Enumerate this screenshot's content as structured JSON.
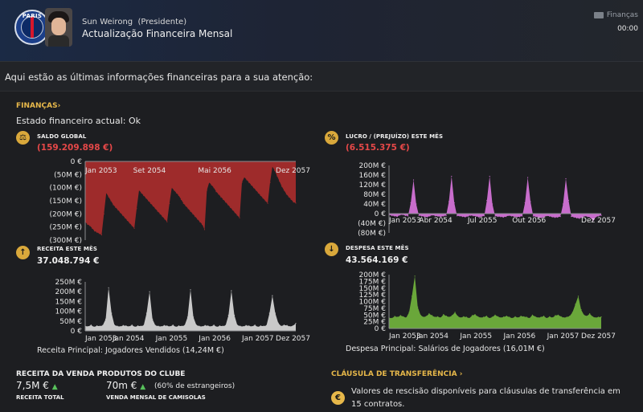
{
  "header": {
    "crest_text": "PARIS",
    "sender_name": "Sun Weirong",
    "sender_role": "(Presidente)",
    "subject": "Actualização Financeira Mensal",
    "tag": "Finanças",
    "time": "00:00"
  },
  "intro": "Aqui estão as últimas informações financeiras para a sua atenção:",
  "finances": {
    "section_label": "FINANÇAS",
    "status": "Estado financeiro actual: Ok"
  },
  "saldo": {
    "label": "SALDO GLOBAL",
    "value": "(159.209.898 €)"
  },
  "lucro": {
    "label": "LUCRO / (PREJUÍZO) ESTE MÊS",
    "value": "(6.515.375 €)"
  },
  "receita": {
    "label": "RECEITA ESTE MÊS",
    "value": "37.048.794 €",
    "principal": "Receita Principal: Jogadores Vendidos (14,24M €)"
  },
  "despesa": {
    "label": "DESPESA ESTE MÊS",
    "value": "43.564.169 €",
    "principal": "Despesa Principal: Salários de Jogadores (16,01M €)"
  },
  "vendas": {
    "title": "RECEITA DA VENDA PRODUTOS DO CLUBE",
    "total_value": "7,5M €",
    "total_label": "RECEITA TOTAL",
    "shirts_value": "70m €",
    "shirts_note": "(60% de estrangeiros)",
    "shirts_label": "VENDA MENSAL DE CAMISOLAS"
  },
  "clausula": {
    "title": "CLÁUSULA DE TRANSFERÊNCIA",
    "text": "Valores de rescisão disponíveis para cláusulas de transferência em 15 contratos."
  },
  "colors": {
    "accent": "#e7b84a",
    "negative": "#e54848",
    "balance_fill": "#9e2b2b",
    "profit_fill": "#c86dcc",
    "income_fill": "#c9c9c9",
    "expense_fill": "#6aa73a"
  },
  "icons": {
    "saldo": "balance-scale-icon",
    "lucro": "percent-icon",
    "receita": "arrow-up-icon",
    "despesa": "arrow-down-icon",
    "clausula": "euro-icon"
  },
  "chart_data": [
    {
      "id": "saldo",
      "type": "area",
      "title": "SALDO GLOBAL",
      "unit": "€",
      "ylim": [
        -300,
        0
      ],
      "yticks": [
        0,
        -50,
        -100,
        -150,
        -200,
        -250,
        -300
      ],
      "ytick_labels": [
        "0 €",
        "(50M €)",
        "(100M €)",
        "(150M €)",
        "(200M €)",
        "(250M €)",
        "(300M €)"
      ],
      "xtick_labels": [
        "Jan 2053",
        "Set 2054",
        "Mai 2056",
        "Dez 2057"
      ],
      "xtick_pos": [
        0.0,
        0.305,
        0.615,
        1.0
      ],
      "values": [
        -230,
        -240,
        -245,
        -255,
        -265,
        -270,
        -275,
        -280,
        -200,
        -120,
        -135,
        -150,
        -165,
        -175,
        -185,
        -195,
        -205,
        -215,
        -225,
        -235,
        -245,
        -255,
        -180,
        -110,
        -120,
        -130,
        -140,
        -150,
        -160,
        -170,
        -180,
        -190,
        -200,
        -210,
        -220,
        -230,
        -160,
        -100,
        -110,
        -120,
        -130,
        -145,
        -160,
        -170,
        -180,
        -190,
        -200,
        -210,
        -220,
        -230,
        -240,
        -260,
        -110,
        -80,
        -90,
        -100,
        -115,
        -125,
        -135,
        -145,
        -155,
        -165,
        -175,
        -185,
        -195,
        -205,
        -215,
        -80,
        -60,
        -70,
        -80,
        -90,
        -100,
        -110,
        -120,
        -130,
        -140,
        -150,
        -160,
        -80,
        -20,
        -35,
        -55,
        -75,
        -95,
        -110,
        -125,
        -135,
        -145,
        -155,
        -159
      ]
    },
    {
      "id": "lucro",
      "type": "area",
      "title": "LUCRO / (PREJUÍZO) ESTE MÊS",
      "unit": "€",
      "ylim": [
        -80,
        200
      ],
      "yticks": [
        200,
        160,
        120,
        80,
        40,
        0,
        -40,
        -80
      ],
      "ytick_labels": [
        "200M €",
        "160M €",
        "120M €",
        "80M €",
        "40M €",
        "0 €",
        "(40M €)",
        "(80M €)"
      ],
      "xtick_labels": [
        "Jan 2053",
        "Abr 2054",
        "Jul 2055",
        "Out 2056",
        "Dez 2057"
      ],
      "xtick_pos": [
        0.0,
        0.22,
        0.44,
        0.66,
        1.0
      ],
      "values": [
        -5,
        -8,
        -10,
        -12,
        -6,
        -4,
        -8,
        -10,
        45,
        140,
        40,
        -8,
        -10,
        -12,
        -14,
        -10,
        -6,
        -9,
        -11,
        -13,
        -10,
        -8,
        50,
        155,
        45,
        -9,
        -10,
        -12,
        -14,
        -11,
        -7,
        -9,
        -11,
        -14,
        -12,
        -9,
        55,
        155,
        40,
        -10,
        -12,
        -13,
        -15,
        -12,
        -8,
        -10,
        -12,
        -14,
        -13,
        -10,
        45,
        150,
        50,
        -10,
        -13,
        -15,
        -17,
        -14,
        -9,
        -11,
        -14,
        -16,
        -15,
        -12,
        40,
        145,
        55,
        -12,
        -15,
        -18,
        -20,
        -16,
        -10,
        -13,
        -16,
        -30,
        -14,
        -10,
        -7
      ]
    },
    {
      "id": "receita",
      "type": "area",
      "title": "RECEITA ESTE MÊS",
      "unit": "€",
      "ylim": [
        0,
        250
      ],
      "yticks": [
        0,
        50,
        100,
        150,
        200,
        250
      ],
      "ytick_labels": [
        "0 €",
        "50M €",
        "100M €",
        "150M €",
        "200M €",
        "250M €"
      ],
      "xtick_labels": [
        "Jan 2053",
        "Jan 2054",
        "Jan 2055",
        "Jan 2056",
        "Jan 2057",
        "Dez 2057"
      ],
      "xtick_pos": [
        0.0,
        0.205,
        0.41,
        0.615,
        0.82,
        1.0
      ],
      "values": [
        25,
        22,
        30,
        20,
        26,
        24,
        28,
        60,
        220,
        90,
        30,
        24,
        22,
        28,
        26,
        22,
        30,
        20,
        26,
        24,
        28,
        90,
        200,
        60,
        28,
        24,
        22,
        28,
        26,
        22,
        30,
        20,
        26,
        24,
        28,
        70,
        210,
        70,
        30,
        24,
        22,
        28,
        26,
        22,
        30,
        20,
        26,
        24,
        28,
        80,
        205,
        80,
        30,
        24,
        22,
        28,
        26,
        22,
        30,
        20,
        26,
        24,
        28,
        90,
        180,
        90,
        40,
        24,
        30,
        28,
        22,
        26,
        38
      ]
    },
    {
      "id": "despesa",
      "type": "area",
      "title": "DESPESA ESTE MÊS",
      "unit": "€",
      "ylim": [
        0,
        200
      ],
      "yticks": [
        0,
        25,
        50,
        75,
        100,
        125,
        150,
        175,
        200
      ],
      "ytick_labels": [
        "0 €",
        "25M €",
        "50M €",
        "75M €",
        "100M €",
        "125M €",
        "150M €",
        "175M €",
        "200M €"
      ],
      "xtick_labels": [
        "Jan 2053",
        "Jan 2054",
        "Jan 2055",
        "Jan 2056",
        "Jan 2057",
        "Dez 2057"
      ],
      "xtick_pos": [
        0.0,
        0.205,
        0.41,
        0.615,
        0.82,
        1.0
      ],
      "values": [
        40,
        38,
        45,
        42,
        48,
        44,
        40,
        60,
        120,
        195,
        80,
        50,
        42,
        45,
        55,
        48,
        42,
        44,
        40,
        52,
        46,
        42,
        48,
        60,
        45,
        40,
        44,
        42,
        38,
        48,
        52,
        44,
        40,
        42,
        46,
        38,
        42,
        50,
        44,
        40,
        43,
        46,
        42,
        38,
        44,
        40,
        46,
        44,
        42,
        38,
        50,
        44,
        40,
        42,
        46,
        38,
        44,
        40,
        48,
        50,
        44,
        40,
        42,
        46,
        60,
        90,
        120,
        70,
        50,
        46,
        55,
        44,
        40,
        42,
        43
      ]
    }
  ]
}
